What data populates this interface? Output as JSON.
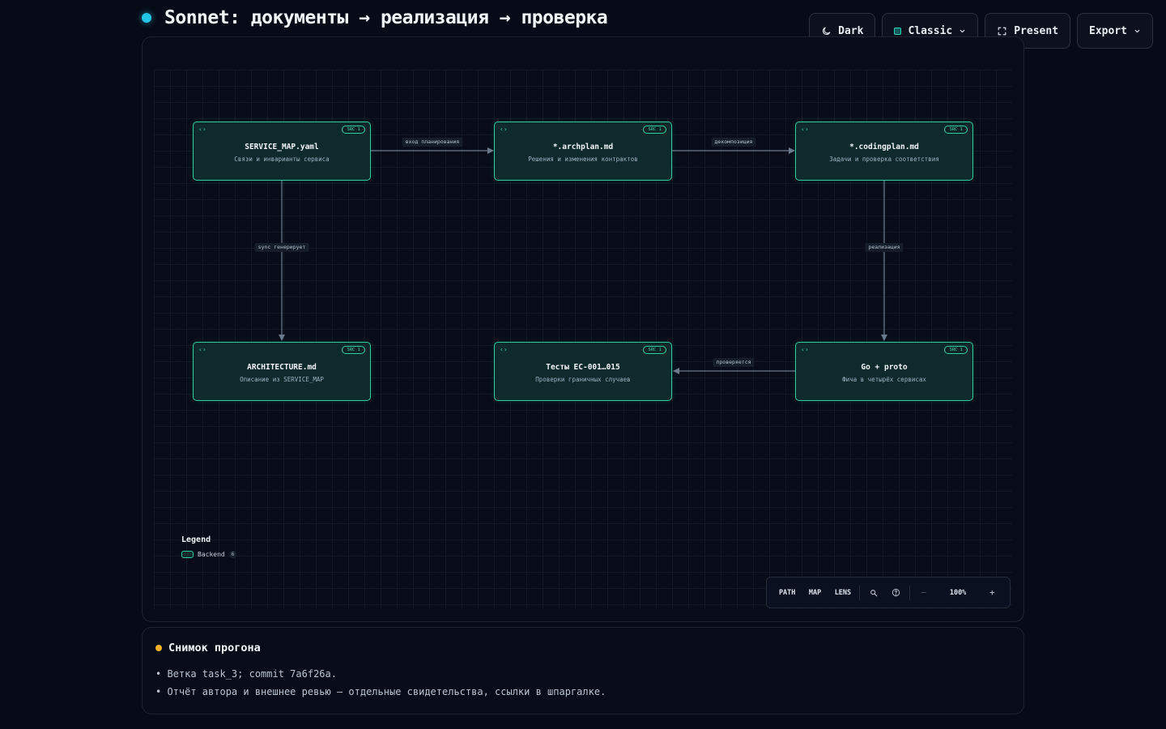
{
  "header": {
    "title": "Sonnet: документы → реализация → проверка"
  },
  "toolbar": {
    "theme_label": "Dark",
    "style_label": "Classic",
    "present_label": "Present",
    "export_label": "Export"
  },
  "colors": {
    "accent": "#22c7e8",
    "node_border": "#2fcf9f",
    "node_fill": "#0e2a2c",
    "notes_dot": "#f5b324",
    "edge": "#6b7a8d"
  },
  "diagram": {
    "nodes": [
      {
        "id": "service_map",
        "title": "SERVICE_MAP.yaml",
        "subtitle": "Связи и инварианты сервиса",
        "badge": "SRC 1",
        "icon": "code-brackets-icon"
      },
      {
        "id": "archplan",
        "title": "*.archplan.md",
        "subtitle": "Решения и изменения контрактов",
        "badge": "SRC 1",
        "icon": "code-brackets-icon"
      },
      {
        "id": "codingplan",
        "title": "*.codingplan.md",
        "subtitle": "Задачи и проверка соответствия",
        "badge": "SRC 1",
        "icon": "code-brackets-icon"
      },
      {
        "id": "architecture",
        "title": "ARCHITECTURE.md",
        "subtitle": "Описание из SERVICE_MAP",
        "badge": "SRC 1",
        "icon": "code-brackets-icon"
      },
      {
        "id": "tests",
        "title": "Тесты EC-001…015",
        "subtitle": "Проверки граничных случаев",
        "badge": "SRC 1",
        "icon": "code-brackets-icon"
      },
      {
        "id": "go_proto",
        "title": "Go + proto",
        "subtitle": "Фича в четырёх сервисах",
        "badge": "SRC 1",
        "icon": "code-brackets-icon"
      }
    ],
    "edges": [
      {
        "from": "service_map",
        "to": "archplan",
        "label": "вход планирования"
      },
      {
        "from": "archplan",
        "to": "codingplan",
        "label": "декомпозиция"
      },
      {
        "from": "service_map",
        "to": "architecture",
        "label": "sync генерирует"
      },
      {
        "from": "codingplan",
        "to": "go_proto",
        "label": "реализация"
      },
      {
        "from": "go_proto",
        "to": "tests",
        "label": "проверяется"
      }
    ],
    "legend": {
      "title": "Legend",
      "items": [
        {
          "label": "Backend",
          "count": "6"
        }
      ]
    },
    "controls": {
      "modes": [
        "PATH",
        "MAP",
        "LENS"
      ],
      "zoom": "100%"
    }
  },
  "notes": {
    "title": "Снимок прогона",
    "items": [
      "• Ветка task_3; commit 7a6f26a.",
      "• Отчёт автора и внешнее ревью — отдельные свидетельства, ссылки в шпаргалке."
    ]
  }
}
